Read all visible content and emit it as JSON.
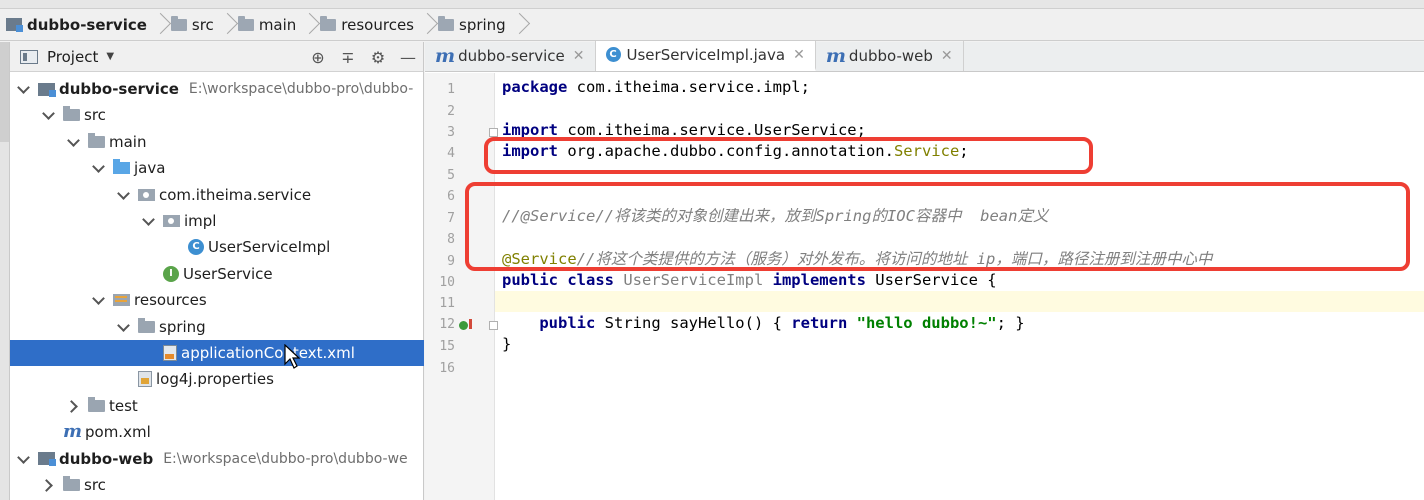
{
  "breadcrumb": [
    "dubbo-service",
    "src",
    "main",
    "resources",
    "spring"
  ],
  "project_panel": {
    "title": "Project",
    "tree": [
      {
        "name": "dubbo-service",
        "path": "E:\\workspace\\dubbo-pro\\dubbo-",
        "arrow": "down",
        "icon": "module-icon",
        "indent": 0,
        "bold": true
      },
      {
        "name": "src",
        "arrow": "down",
        "icon": "folder-icon",
        "indent": 1
      },
      {
        "name": "main",
        "arrow": "down",
        "icon": "folder-icon",
        "indent": 2
      },
      {
        "name": "java",
        "arrow": "down",
        "icon": "source-folder-icon",
        "indent": 3
      },
      {
        "name": "com.itheima.service",
        "arrow": "down",
        "icon": "package-icon",
        "indent": 4
      },
      {
        "name": "impl",
        "arrow": "down",
        "icon": "package-icon",
        "indent": 5
      },
      {
        "name": "UserServiceImpl",
        "arrow": "none",
        "icon": "class-icon",
        "indent": 6
      },
      {
        "name": "UserService",
        "arrow": "none",
        "icon": "interface-icon",
        "indent": 5
      },
      {
        "name": "resources",
        "arrow": "down",
        "icon": "resources-folder-icon",
        "indent": 3
      },
      {
        "name": "spring",
        "arrow": "down",
        "icon": "folder-icon",
        "indent": 4
      },
      {
        "name": "applicationContext.xml",
        "arrow": "none",
        "icon": "xml-file-icon",
        "indent": 5,
        "selected": true
      },
      {
        "name": "log4j.properties",
        "arrow": "none",
        "icon": "properties-file-icon",
        "indent": 4
      },
      {
        "name": "test",
        "arrow": "right",
        "icon": "folder-icon",
        "indent": 2
      },
      {
        "name": "pom.xml",
        "arrow": "none",
        "icon": "maven-icon",
        "indent": 1
      },
      {
        "name": "dubbo-web",
        "path": "E:\\workspace\\dubbo-pro\\dubbo-we",
        "arrow": "down",
        "icon": "module-icon",
        "indent": 0,
        "bold": true
      },
      {
        "name": "src",
        "arrow": "right",
        "icon": "folder-icon",
        "indent": 1
      }
    ]
  },
  "editor": {
    "tabs": [
      {
        "label": "dubbo-service",
        "icon": "maven-icon",
        "active": false
      },
      {
        "label": "UserServiceImpl.java",
        "icon": "class-icon",
        "active": true
      },
      {
        "label": "dubbo-web",
        "icon": "maven-icon",
        "active": false
      }
    ],
    "line_numbers": [
      "1",
      "2",
      "3",
      "4",
      "5",
      "6",
      "7",
      "8",
      "9",
      "10",
      "11",
      "12",
      "15",
      "16"
    ],
    "code": {
      "l1_kw": "package",
      "l1_rest": " com.itheima.service.impl;",
      "l3_kw": "import",
      "l3_rest": " com.itheima.service.UserService;",
      "l4_kw": "import",
      "l4_rest": " org.apache.dubbo.config.annotation.",
      "l4_ann": "Service",
      "l4_end": ";",
      "l7_comment": "//@Service//将该类的对象创建出来，放到Spring的IOC容器中  bean定义",
      "l9_ann": "@Service",
      "l9_comment": "//将这个类提供的方法（服务）对外发布。将访问的地址 ip，端口，路径注册到注册中心中",
      "l10_kw": "public class",
      "l10_name": " UserServiceImpl ",
      "l10_kw2": "implements",
      "l10_rest": " UserService {",
      "l12_kw": "    public",
      "l12_rest": " String sayHello() { ",
      "l12_ret": "return",
      "l12_str": " \"hello dubbo!~\"",
      "l12_end": "; }",
      "l15": "}"
    }
  },
  "colors": {
    "highlight_box": "#ee3e33",
    "selection": "#2f6ec8",
    "keyword": "#000080",
    "annotation": "#808000",
    "string": "#008000"
  }
}
